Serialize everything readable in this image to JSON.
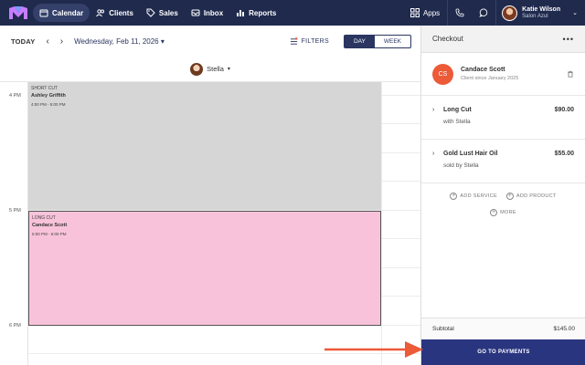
{
  "nav": {
    "items": [
      {
        "label": "Calendar",
        "icon": "calendar-icon",
        "active": true
      },
      {
        "label": "Clients",
        "icon": "clients-icon",
        "active": false
      },
      {
        "label": "Sales",
        "icon": "tag-icon",
        "active": false
      },
      {
        "label": "Inbox",
        "icon": "inbox-icon",
        "active": false
      },
      {
        "label": "Reports",
        "icon": "chart-icon",
        "active": false
      }
    ],
    "apps_label": "Apps",
    "user": {
      "name": "Katie Wilson",
      "salon": "Salon Azul"
    }
  },
  "toolbar": {
    "today_label": "TODAY",
    "date_label": "Wednesday, Feb 11, 2026",
    "filters_label": "FILTERS",
    "view_day": "DAY",
    "view_week": "WEEK",
    "active_view": "DAY"
  },
  "staff": {
    "name": "Stella"
  },
  "calendar": {
    "times": [
      "4 PM",
      "5 PM",
      "6 PM"
    ],
    "appointments": [
      {
        "service": "SHORT CUT",
        "client": "Ashley Griffith",
        "range": "4:00 PM - 5:00 PM",
        "color": "#d6d6d6"
      },
      {
        "service": "LONG CUT",
        "client": "Candace Scott",
        "range": "5:00 PM - 6:00 PM",
        "color": "#f8c3da"
      }
    ]
  },
  "checkout": {
    "title": "Checkout",
    "client": {
      "initials": "CS",
      "name": "Candace Scott",
      "since": "Client since January 2025",
      "avatar_color": "#ec5a38"
    },
    "items": [
      {
        "name": "Long Cut",
        "price": "$90.00",
        "sub": "with Stella"
      },
      {
        "name": "Gold Lust Hair Oil",
        "price": "$55.00",
        "sub": "sold by Stella"
      }
    ],
    "add_service": "ADD SERVICE",
    "add_product": "ADD PRODUCT",
    "more": "MORE",
    "subtotal_label": "Subtotal",
    "subtotal_value": "$145.00",
    "pay_button": "GO TO PAYMENTS"
  },
  "colors": {
    "nav_bg": "#1f2a4d",
    "accent": "#2a3580",
    "arrow": "#ec5a38"
  }
}
